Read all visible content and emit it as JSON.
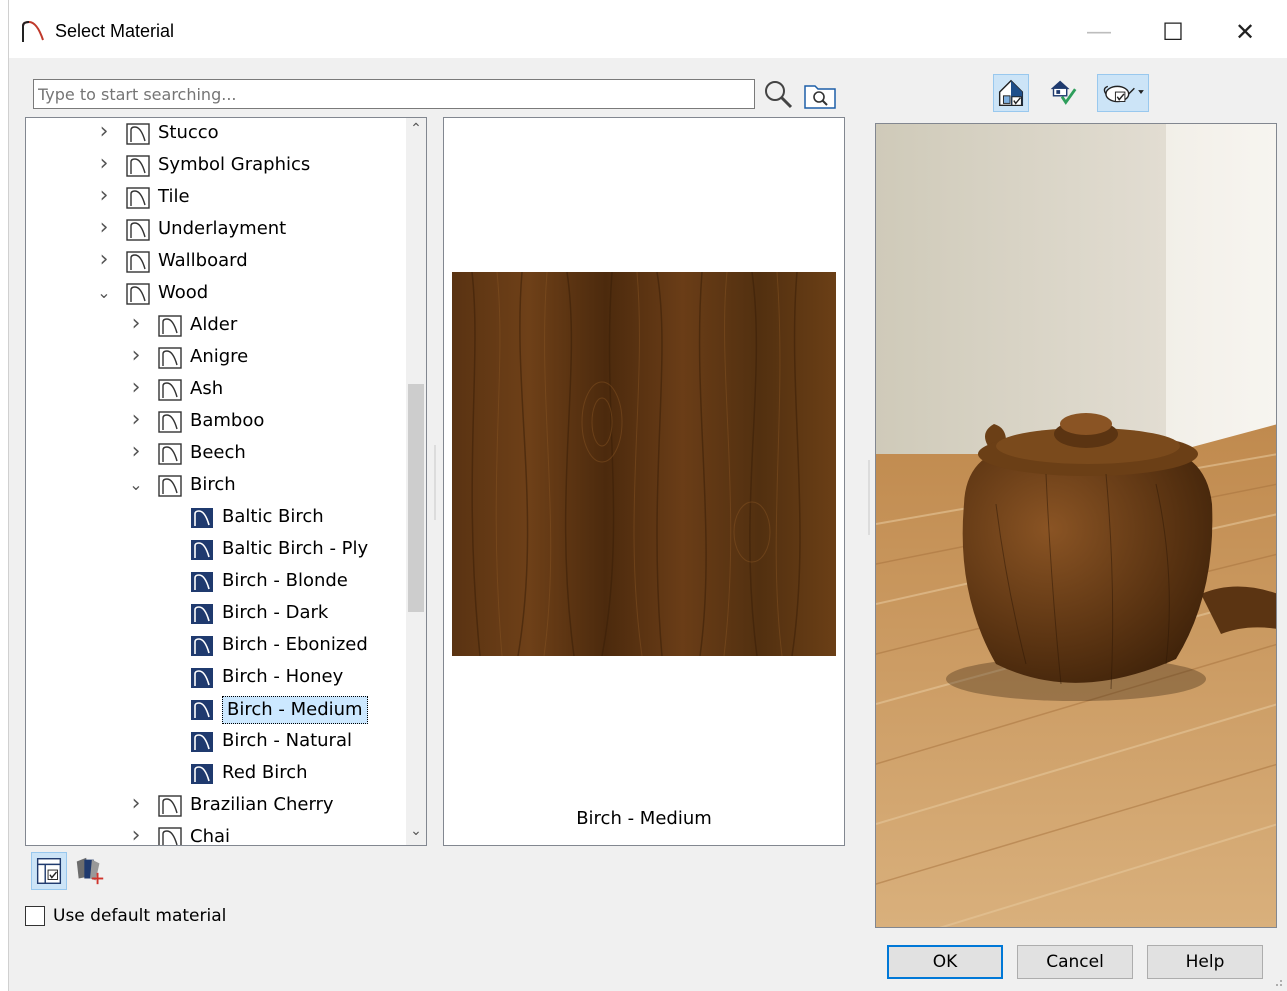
{
  "window": {
    "title": "Select Material",
    "minimize_glyph": "—",
    "maximize_glyph": "☐",
    "close_glyph": "✕"
  },
  "search": {
    "placeholder": "Type to start searching..."
  },
  "tree": {
    "items": [
      {
        "label": "Stucco",
        "type": "folder",
        "state": "collapsed"
      },
      {
        "label": "Symbol Graphics",
        "type": "folder",
        "state": "collapsed"
      },
      {
        "label": "Tile",
        "type": "folder",
        "state": "collapsed"
      },
      {
        "label": "Underlayment",
        "type": "folder",
        "state": "collapsed"
      },
      {
        "label": "Wallboard",
        "type": "folder",
        "state": "collapsed"
      },
      {
        "label": "Wood",
        "type": "folder",
        "state": "expanded"
      },
      {
        "label": "Alder",
        "type": "folder",
        "state": "collapsed"
      },
      {
        "label": "Anigre",
        "type": "folder",
        "state": "collapsed"
      },
      {
        "label": "Ash",
        "type": "folder",
        "state": "collapsed"
      },
      {
        "label": "Bamboo",
        "type": "folder",
        "state": "collapsed"
      },
      {
        "label": "Beech",
        "type": "folder",
        "state": "collapsed"
      },
      {
        "label": "Birch",
        "type": "folder",
        "state": "expanded"
      },
      {
        "label": "Baltic Birch",
        "type": "material"
      },
      {
        "label": "Baltic Birch - Ply",
        "type": "material"
      },
      {
        "label": "Birch - Blonde",
        "type": "material"
      },
      {
        "label": "Birch - Dark",
        "type": "material"
      },
      {
        "label": "Birch - Ebonized",
        "type": "material"
      },
      {
        "label": "Birch - Honey",
        "type": "material"
      },
      {
        "label": "Birch - Medium",
        "type": "material",
        "selected": true
      },
      {
        "label": "Birch - Natural",
        "type": "material"
      },
      {
        "label": "Red Birch",
        "type": "material"
      },
      {
        "label": "Brazilian Cherry",
        "type": "folder",
        "state": "collapsed"
      },
      {
        "label": "Chai",
        "type": "folder",
        "state": "collapsed"
      }
    ]
  },
  "preview": {
    "material_name": "Birch - Medium"
  },
  "toolbar": {
    "icons": [
      "exterior-house-view-icon",
      "house-check-icon",
      "object-view-dropdown-icon"
    ]
  },
  "bottom": {
    "icons": [
      "library-browser-icon",
      "add-material-icon"
    ],
    "use_default_label": "Use default material",
    "use_default_checked": false
  },
  "buttons": {
    "ok": "OK",
    "cancel": "Cancel",
    "help": "Help"
  },
  "colors": {
    "selection": "#cce8ff",
    "accent": "#0078d7",
    "material_icon": "#1f3a6e",
    "wood_dark": "#4a2a0e",
    "wood_mid": "#6b3f16"
  }
}
